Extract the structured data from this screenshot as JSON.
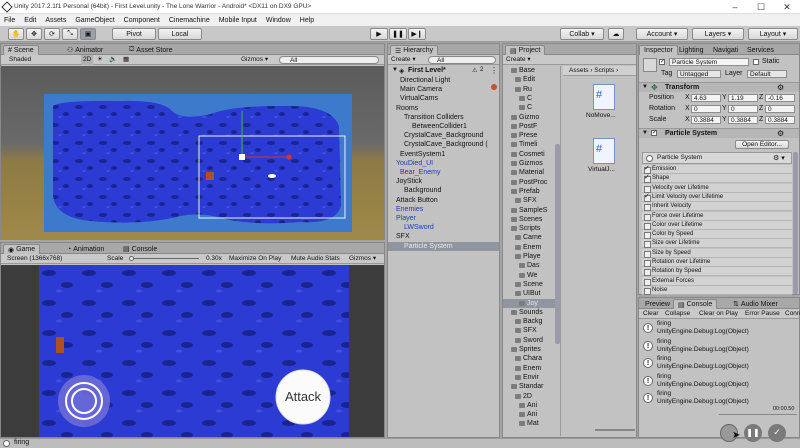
{
  "window": {
    "title": "Unity 2017.2.1f1 Personal (64bit) - First Level.unity - The Lone Warrior - Android* <DX11 on DX9 GPU>",
    "minimize": "–",
    "maximize": "☐",
    "close": "✕"
  },
  "menu": [
    "File",
    "Edit",
    "Assets",
    "GameObject",
    "Component",
    "Cinemachine",
    "Mobile Input",
    "Window",
    "Help"
  ],
  "toolbar": {
    "pivot": "Pivot",
    "local": "Local",
    "collab": "Collab ▾",
    "account": "Account ▾",
    "layers": "Layers ▾",
    "layout": "Layout ▾"
  },
  "scene": {
    "tabs": [
      "Scene",
      "Animator",
      "Asset Store"
    ],
    "shading": "Shaded",
    "mode_2d": "2D",
    "gizmos": "Gizmos ▾",
    "search": "All"
  },
  "game": {
    "tabs": [
      "Game",
      "Animation",
      "Console"
    ],
    "display": "Screen (1366x768)",
    "scale_label": "Scale",
    "scale_value": "0.30x",
    "options": [
      "Maximize On Play",
      "Mute Audio",
      "Stats",
      "Gizmos ▾"
    ],
    "attack": "Attack"
  },
  "hierarchy": {
    "tab": "Hierarchy",
    "create": "Create ▾",
    "search": "All",
    "scene_name": "First Level*",
    "count": "2",
    "items": [
      {
        "label": "Directional Light",
        "indent": 3,
        "style": ""
      },
      {
        "label": "Main Camera",
        "indent": 3,
        "style": ""
      },
      {
        "label": "VirtualCams",
        "indent": 3,
        "style": ""
      },
      {
        "label": "Rooms",
        "indent": 2,
        "style": ""
      },
      {
        "label": "Transition Colliders",
        "indent": 4,
        "style": ""
      },
      {
        "label": "BetweenCollider1",
        "indent": 6,
        "style": ""
      },
      {
        "label": "CrystalCave_Background",
        "indent": 4,
        "style": ""
      },
      {
        "label": "CrystalCave_Background (",
        "indent": 4,
        "style": ""
      },
      {
        "label": "EventSystem1",
        "indent": 3,
        "style": ""
      },
      {
        "label": "YouDied_UI",
        "indent": 2,
        "style": "blue"
      },
      {
        "label": "Bear_Enemy",
        "indent": 3,
        "style": "blue"
      },
      {
        "label": "JoyStick",
        "indent": 2,
        "style": ""
      },
      {
        "label": "Background",
        "indent": 4,
        "style": ""
      },
      {
        "label": "Attack Button",
        "indent": 2,
        "style": ""
      },
      {
        "label": "Enemies",
        "indent": 2,
        "style": "blue"
      },
      {
        "label": "Player",
        "indent": 2,
        "style": "blue"
      },
      {
        "label": "LWSword",
        "indent": 4,
        "style": "blue"
      },
      {
        "label": "SFX",
        "indent": 2,
        "style": ""
      },
      {
        "label": "Particle System",
        "indent": 4,
        "style": "sel"
      }
    ]
  },
  "project": {
    "tab": "Project",
    "create": "Create ▾",
    "tree": [
      "Base",
      "Edit",
      "Ru",
      "C",
      "C",
      "Gizmo",
      "PostF",
      "Prese",
      "Timeli",
      "Cosmeti",
      "Gizmos",
      "Material",
      "PostProc",
      "Prefab",
      "SFX",
      "SampleS",
      "Scenes",
      "Scripts",
      "Came",
      "Enem",
      "Playe",
      "Das",
      "We",
      "Scene",
      "UIBut",
      "Joy",
      "Sounds",
      "Backg",
      "SFX",
      "Sword",
      "Sprites",
      "Chara",
      "Enem",
      "Envir",
      "Standar",
      "2D",
      "Ani",
      "Ani",
      "Mat"
    ],
    "breadcrumb": "Assets › Scripts ›",
    "files": [
      "NoMove...",
      "VirtualJ..."
    ]
  },
  "inspector": {
    "tabs": [
      "Inspector",
      "Lighting",
      "Navigati",
      "Services"
    ],
    "object_name": "Particle System",
    "static_label": "Static",
    "tag_label": "Tag",
    "tag_value": "Untagged",
    "layer_label": "Layer",
    "layer_value": "Default",
    "transform": {
      "title": "Transform",
      "rows": [
        {
          "label": "Position",
          "x": "4.63",
          "y": "1.19",
          "z": "-0.16"
        },
        {
          "label": "Rotation",
          "x": "0",
          "y": "0",
          "z": "0"
        },
        {
          "label": "Scale",
          "x": "0.3884",
          "y": "0.3884",
          "z": "0.3884"
        }
      ]
    },
    "ps_title": "Particle System",
    "open_editor": "Open Editor...",
    "ps_name": "Particle System",
    "modules": [
      {
        "label": "Emission",
        "on": true
      },
      {
        "label": "Shape",
        "on": true
      },
      {
        "label": "Velocity over Lifetime",
        "on": false
      },
      {
        "label": "Limit Velocity over Lifetime",
        "on": true
      },
      {
        "label": "Inherit Velocity",
        "on": false
      },
      {
        "label": "Force over Lifetime",
        "on": false
      },
      {
        "label": "Color over Lifetime",
        "on": false
      },
      {
        "label": "Color by Speed",
        "on": false
      },
      {
        "label": "Size over Lifetime",
        "on": false
      },
      {
        "label": "Size by Speed",
        "on": false
      },
      {
        "label": "Rotation over Lifetime",
        "on": false
      },
      {
        "label": "Rotation by Speed",
        "on": false
      },
      {
        "label": "External Forces",
        "on": false
      },
      {
        "label": "Noise",
        "on": false
      }
    ]
  },
  "console": {
    "tabs": [
      "Preview",
      "Console",
      "Audio Mixer"
    ],
    "buttons": [
      "Clear",
      "Collapse",
      "Clear on Play",
      "Error Pause",
      "Conn"
    ],
    "entries": [
      {
        "line1": "firing",
        "line2": "UnityEngine.Debug:Log(Object)"
      },
      {
        "line1": "firing",
        "line2": "UnityEngine.Debug:Log(Object)"
      },
      {
        "line1": "firing",
        "line2": "UnityEngine.Debug:Log(Object)"
      },
      {
        "line1": "firing",
        "line2": "UnityEngine.Debug:Log(Object)"
      },
      {
        "line1": "firing",
        "line2": "UnityEngine.Debug:Log(Object)"
      }
    ],
    "time": "00:00.50"
  },
  "status": {
    "message": "firing"
  },
  "colors": {
    "cave": "#2b3bd3",
    "cave_dark": "#1a2490",
    "ground": "#3e7acb",
    "sand": "#8d7a45",
    "selection": "#8f96a0"
  }
}
